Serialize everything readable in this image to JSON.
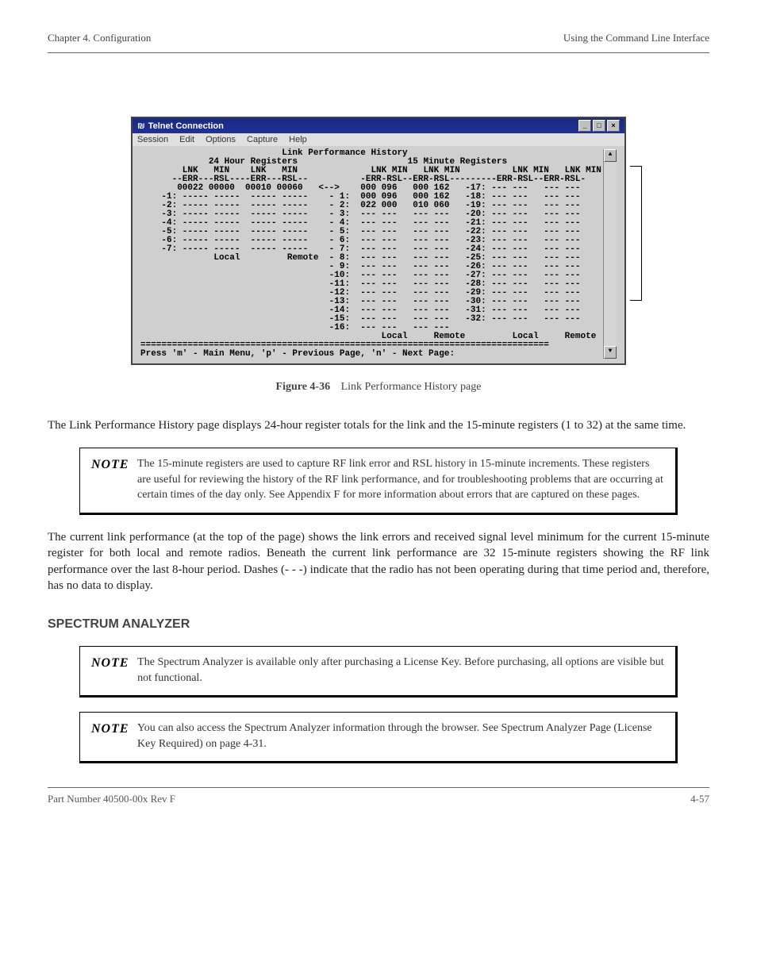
{
  "header": {
    "left": "Chapter 4.  Configuration",
    "right": "Using the Command Line Interface"
  },
  "telnet": {
    "title": "Telnet Connection",
    "window_buttons": {
      "min": "_",
      "max": "□",
      "close": "×"
    },
    "menu": [
      "Session",
      "Edit",
      "Options",
      "Capture",
      "Help"
    ],
    "scroll": {
      "up": "▲",
      "down": "▼"
    },
    "screen_text": "                           Link Performance History\n             24 Hour Registers                     15 Minute Registers\n        LNK   MIN    LNK   MIN              LNK MIN   LNK MIN          LNK MIN   LNK MIN\n      --ERR---RSL----ERR---RSL--          -ERR-RSL--ERR-RSL---------ERR-RSL--ERR-RSL-\n       00022 00000  00010 00060   <-->    000 096   000 162   -17: --- ---   --- ---\n    -1: ----- -----  ----- -----    - 1:  000 096   000 162   -18: --- ---   --- ---\n    -2: ----- -----  ----- -----    - 2:  022 000   010 060   -19: --- ---   --- ---\n    -3: ----- -----  ----- -----    - 3:  --- ---   --- ---   -20: --- ---   --- ---\n    -4: ----- -----  ----- -----    - 4:  --- ---   --- ---   -21: --- ---   --- ---\n    -5: ----- -----  ----- -----    - 5:  --- ---   --- ---   -22: --- ---   --- ---\n    -6: ----- -----  ----- -----    - 6:  --- ---   --- ---   -23: --- ---   --- ---\n    -7: ----- -----  ----- -----    - 7:  --- ---   --- ---   -24: --- ---   --- ---\n              Local         Remote  - 8:  --- ---   --- ---   -25: --- ---   --- ---\n                                    - 9:  --- ---   --- ---   -26: --- ---   --- ---\n                                    -10:  --- ---   --- ---   -27: --- ---   --- ---\n                                    -11:  --- ---   --- ---   -28: --- ---   --- ---\n                                    -12:  --- ---   --- ---   -29: --- ---   --- ---\n                                    -13:  --- ---   --- ---   -30: --- ---   --- ---\n                                    -14:  --- ---   --- ---   -31: --- ---   --- ---\n                                    -15:  --- ---   --- ---   -32: --- ---   --- ---\n                                    -16:  --- ---   --- ---\n                                              Local     Remote         Local     Remote\n==============================================================================\nPress 'm' - Main Menu, 'p' - Previous Page, 'n' - Next Page:"
  },
  "figure": {
    "label": "Figure 4-36",
    "caption": "Link Performance History page"
  },
  "para1": "The Link Performance History page displays 24-hour register totals for the link and the 15-minute registers (1 to 32) at the same time.",
  "note1": "The 15-minute registers are used to capture RF link error and RSL history in 15-minute increments. These registers are useful for reviewing the history of the RF link performance, and for troubleshooting problems that are occurring at certain times of the day only. See Appendix F for more information about errors that are captured on these pages.",
  "para2": "The current link performance (at the top of the page) shows the link errors and received signal level minimum for the current 15-minute register for both local and remote radios. Beneath the current link performance are 32 15-minute registers showing the RF link performance over the last 8-hour period. Dashes (- - -) indicate that the radio has not been operating during that time period and, therefore, has no data to display.",
  "section_title": "SPECTRUM ANALYZER",
  "note2": "The Spectrum Analyzer is available only after purchasing a License Key. Before purchasing, all options are visible but not functional.",
  "note3": "You can also access the Spectrum Analyzer information through the browser. See Spectrum Analyzer Page (License Key Required) on page 4-31.",
  "footer": {
    "left": "Part Number 40500-00x Rev F",
    "right": "4-57"
  }
}
